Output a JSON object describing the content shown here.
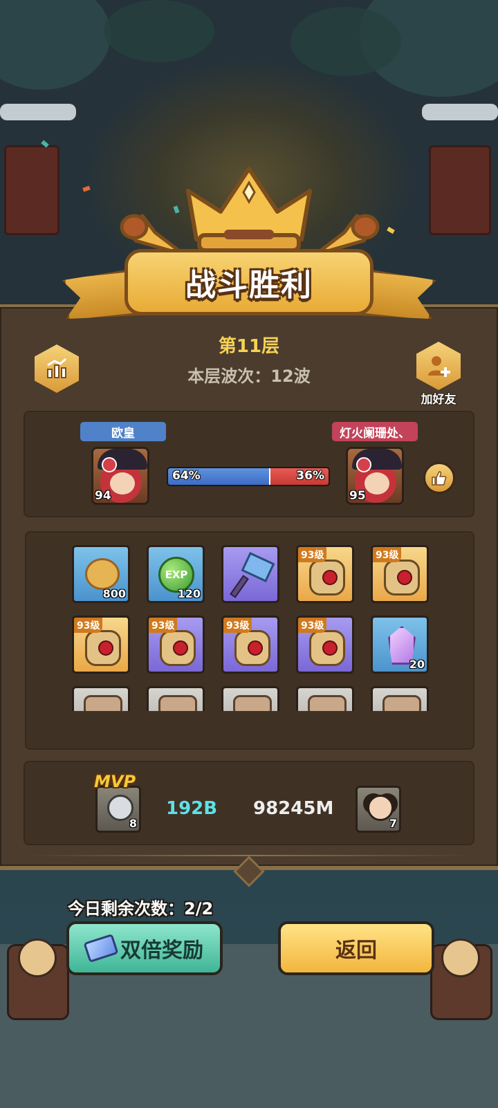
{
  "banner": {
    "title": "战斗胜利"
  },
  "header": {
    "floor_title": "第11层",
    "wave_text": "本层波次：12波",
    "stats_icon": "bar-chart-icon",
    "add_friend_icon": "add-friend-icon",
    "add_friend_label": "加好友"
  },
  "battle": {
    "left_player": {
      "name": "欧皇",
      "level": "94",
      "tag_color": "#4f82c8"
    },
    "right_player": {
      "name": "灯火阑珊处、",
      "level": "95",
      "tag_color": "#c2435a"
    },
    "left_percent": "64%",
    "right_percent": "36%",
    "left_share": 0.64,
    "like_icon": "thumbs-up-icon"
  },
  "rewards": {
    "items": [
      {
        "icon": "gold-coin-icon",
        "rarity": "blue",
        "count": "800"
      },
      {
        "icon": "exp-orb-icon",
        "rarity": "blue",
        "count": "120",
        "text": "EXP"
      },
      {
        "icon": "hammer-icon",
        "rarity": "purple"
      },
      {
        "icon": "gauntlet-icon",
        "rarity": "orange",
        "level": "93级"
      },
      {
        "icon": "chest-armor-icon",
        "rarity": "orange",
        "level": "93级"
      },
      {
        "icon": "amulet-icon",
        "rarity": "orange",
        "level": "93级"
      },
      {
        "icon": "boots-icon",
        "rarity": "purple",
        "level": "93级"
      },
      {
        "icon": "helmet-icon",
        "rarity": "purple",
        "level": "93级"
      },
      {
        "icon": "gauntlet-icon",
        "rarity": "purple",
        "level": "93级"
      },
      {
        "icon": "crystal-icon",
        "rarity": "blue",
        "count": "20"
      },
      {
        "icon": "cat-helmet-icon",
        "rarity": "gray"
      },
      {
        "icon": "cat-helmet-icon",
        "rarity": "gray"
      },
      {
        "icon": "cat-helmet-icon",
        "rarity": "gray"
      },
      {
        "icon": "cat-helmet-icon",
        "rarity": "gray"
      },
      {
        "icon": "cat-helmet-icon",
        "rarity": "gray"
      }
    ]
  },
  "mvp": {
    "tag": "MVP",
    "left_hero_level": "8",
    "left_damage": "192B",
    "right_damage": "98245M",
    "right_hero_level": "7"
  },
  "footer": {
    "remaining_text": "今日剩余次数：2/2",
    "double_reward_label": "双倍奖励",
    "return_label": "返回"
  }
}
